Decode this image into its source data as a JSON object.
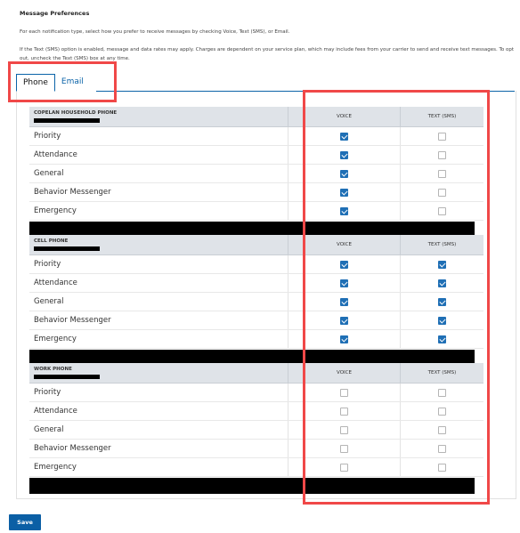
{
  "page": {
    "title": "Message Preferences",
    "intro": "For each notification type, select how you prefer to receive messages by checking Voice, Text (SMS), or Email.",
    "note": "If the Text (SMS) option is enabled, message and data rates may apply. Charges are dependent on your service plan, which may include fees from your carrier to send and receive text messages. To opt out, uncheck the Text (SMS) box at any time."
  },
  "tabs": [
    {
      "label": "Phone",
      "active": true
    },
    {
      "label": "Email",
      "active": false
    }
  ],
  "sections": [
    {
      "heading": "COPELAN HOUSEHOLD PHONE",
      "voice_header": "VOICE",
      "text_header": "TEXT (SMS)",
      "rows": [
        {
          "label": "Priority",
          "voice": true,
          "text": false
        },
        {
          "label": "Attendance",
          "voice": true,
          "text": false
        },
        {
          "label": "General",
          "voice": true,
          "text": false
        },
        {
          "label": "Behavior Messenger",
          "voice": true,
          "text": false
        },
        {
          "label": "Emergency",
          "voice": true,
          "text": false
        }
      ]
    },
    {
      "heading": "CELL PHONE",
      "voice_header": "VOICE",
      "text_header": "TEXT (SMS)",
      "rows": [
        {
          "label": "Priority",
          "voice": true,
          "text": true
        },
        {
          "label": "Attendance",
          "voice": true,
          "text": true
        },
        {
          "label": "General",
          "voice": true,
          "text": true
        },
        {
          "label": "Behavior Messenger",
          "voice": true,
          "text": true
        },
        {
          "label": "Emergency",
          "voice": true,
          "text": true
        }
      ]
    },
    {
      "heading": "WORK PHONE",
      "voice_header": "VOICE",
      "text_header": "TEXT (SMS)",
      "rows": [
        {
          "label": "Priority",
          "voice": false,
          "text": false
        },
        {
          "label": "Attendance",
          "voice": false,
          "text": false
        },
        {
          "label": "General",
          "voice": false,
          "text": false
        },
        {
          "label": "Behavior Messenger",
          "voice": false,
          "text": false
        },
        {
          "label": "Emergency",
          "voice": false,
          "text": false
        }
      ]
    }
  ],
  "save_label": "Save",
  "colors": {
    "accent": "#0b63a8",
    "checkbox_on": "#1f6fb5",
    "highlight": "#f04848",
    "header_bg": "#dfe3e8"
  }
}
